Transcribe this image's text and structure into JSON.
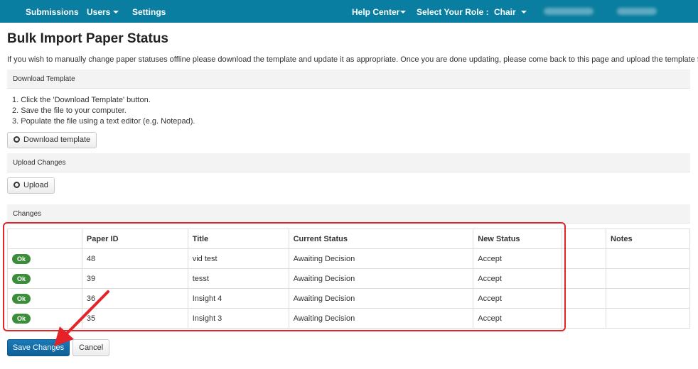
{
  "nav": {
    "left_items": [
      {
        "label": "Submissions"
      },
      {
        "label": "Users"
      },
      {
        "label": "Settings"
      }
    ],
    "help_center": "Help Center",
    "role_label": "Select Your Role :",
    "role_value": "Chair"
  },
  "page_title": "Bulk Import Paper Status",
  "intro": "If you wish to manually change paper statuses offline please download the template and update it as appropriate. Once you are done updating, please come back to this page and upload the template file.",
  "download_section": {
    "title": "Download Template",
    "steps": [
      "1. Click the 'Download Template' button.",
      "2. Save the file to your computer.",
      "3. Populate the file using a text editor (e.g. Notepad)."
    ],
    "button_label": "Download template"
  },
  "upload_section": {
    "title": "Upload Changes",
    "button_label": "Upload"
  },
  "changes_section": {
    "title": "Changes",
    "columns": [
      "",
      "Paper ID",
      "Title",
      "Current Status",
      "New Status",
      "",
      "Notes"
    ],
    "rows": [
      {
        "badge": "Ok",
        "paper_id": "48",
        "title": "vid test",
        "current_status": "Awaiting Decision",
        "new_status": "Accept",
        "extra": "",
        "notes": ""
      },
      {
        "badge": "Ok",
        "paper_id": "39",
        "title": "tesst",
        "current_status": "Awaiting Decision",
        "new_status": "Accept",
        "extra": "",
        "notes": ""
      },
      {
        "badge": "Ok",
        "paper_id": "36",
        "title": "Insight 4",
        "current_status": "Awaiting Decision",
        "new_status": "Accept",
        "extra": "",
        "notes": ""
      },
      {
        "badge": "Ok",
        "paper_id": "35",
        "title": "Insight 3",
        "current_status": "Awaiting Decision",
        "new_status": "Accept",
        "extra": "",
        "notes": ""
      }
    ]
  },
  "actions": {
    "save_label": "Save Changes",
    "cancel_label": "Cancel"
  },
  "colors": {
    "nav_bg": "#0a7ea0",
    "ok_badge": "#3c8d3a",
    "primary": "#1470ad",
    "annotation": "#e52228"
  }
}
